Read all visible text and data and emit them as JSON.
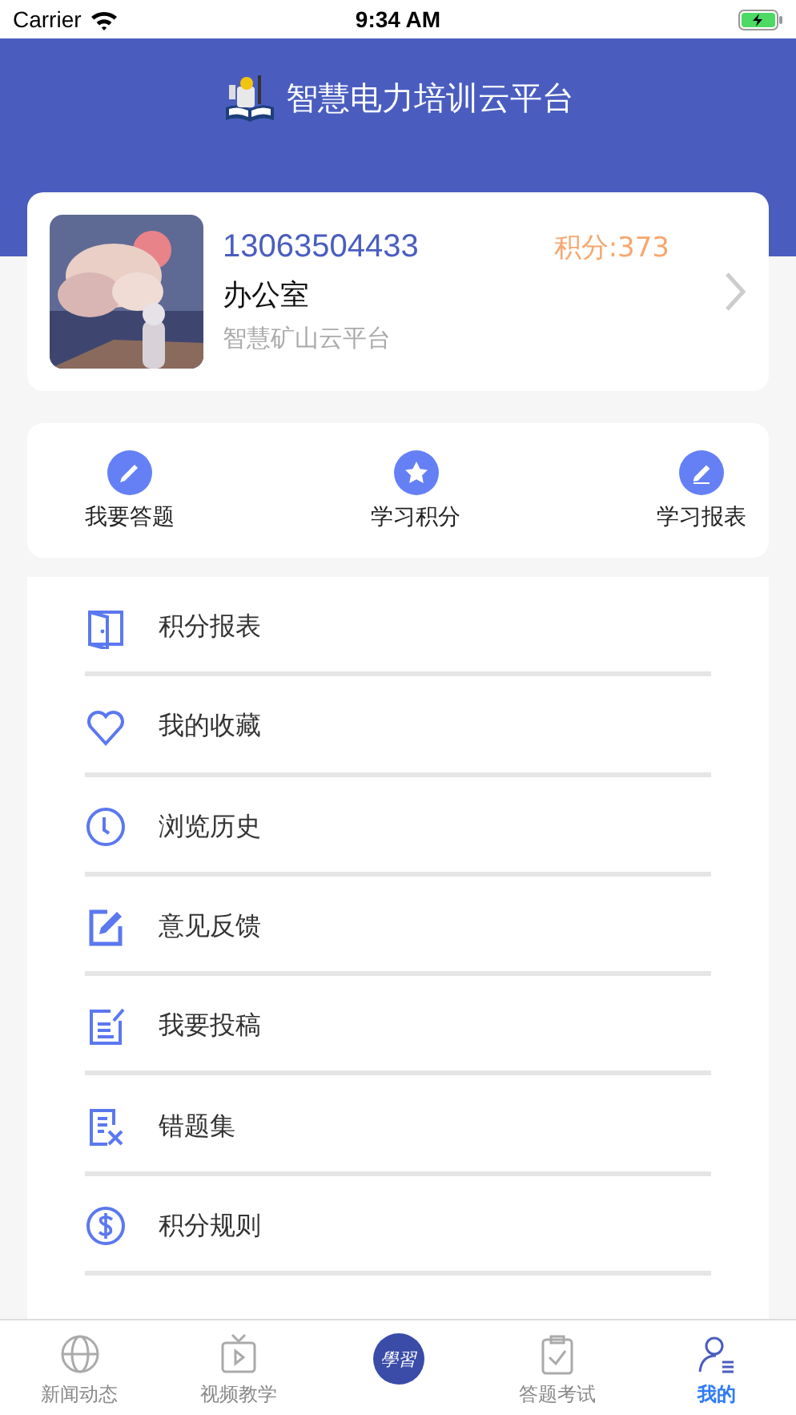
{
  "status_bar": {
    "carrier": "Carrier",
    "time": "9:34 AM"
  },
  "header": {
    "title": "智慧电力培训云平台"
  },
  "profile": {
    "phone": "13063504433",
    "points": "积分:373",
    "name": "办公室",
    "org": "智慧矿山云平台"
  },
  "quick_actions": [
    {
      "label": "我要答题"
    },
    {
      "label": "学习积分"
    },
    {
      "label": "学习报表"
    }
  ],
  "menu": [
    {
      "label": "积分报表"
    },
    {
      "label": "我的收藏"
    },
    {
      "label": "浏览历史"
    },
    {
      "label": "意见反馈"
    },
    {
      "label": "我要投稿"
    },
    {
      "label": "错题集"
    },
    {
      "label": "积分规则"
    }
  ],
  "tab_bar": [
    {
      "kind": "tab",
      "label": "新闻动态",
      "selected": false
    },
    {
      "kind": "tab",
      "label": "视频教学",
      "selected": false
    },
    {
      "kind": "logo",
      "label": "學習",
      "selected": false
    },
    {
      "kind": "tab",
      "label": "答题考试",
      "selected": false
    },
    {
      "kind": "tab",
      "label": "我的",
      "selected": true
    }
  ]
}
